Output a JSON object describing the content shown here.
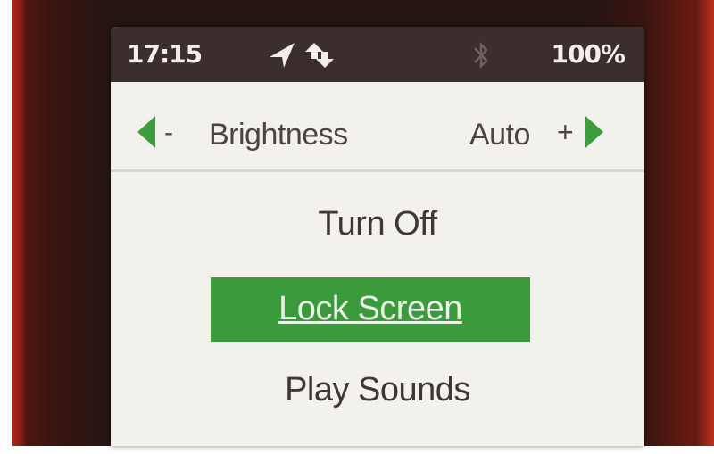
{
  "status_bar": {
    "time": "17:15",
    "battery": "100%",
    "icons": [
      "location-arrow-icon",
      "sync-arrows-icon",
      "bluetooth-icon"
    ]
  },
  "brightness": {
    "minus": "-",
    "label": "Brightness",
    "value": "Auto",
    "plus": "+"
  },
  "menu": {
    "items": [
      {
        "label": "Turn Off",
        "selected": false
      },
      {
        "label": "Lock Screen",
        "selected": true
      },
      {
        "label": "Play Sounds",
        "selected": false
      }
    ]
  },
  "colors": {
    "accent": "#3a9a3c",
    "status_bar_bg": "#3a2f2e",
    "screen_bg": "#f2f1ec",
    "device_body": "#241513"
  }
}
